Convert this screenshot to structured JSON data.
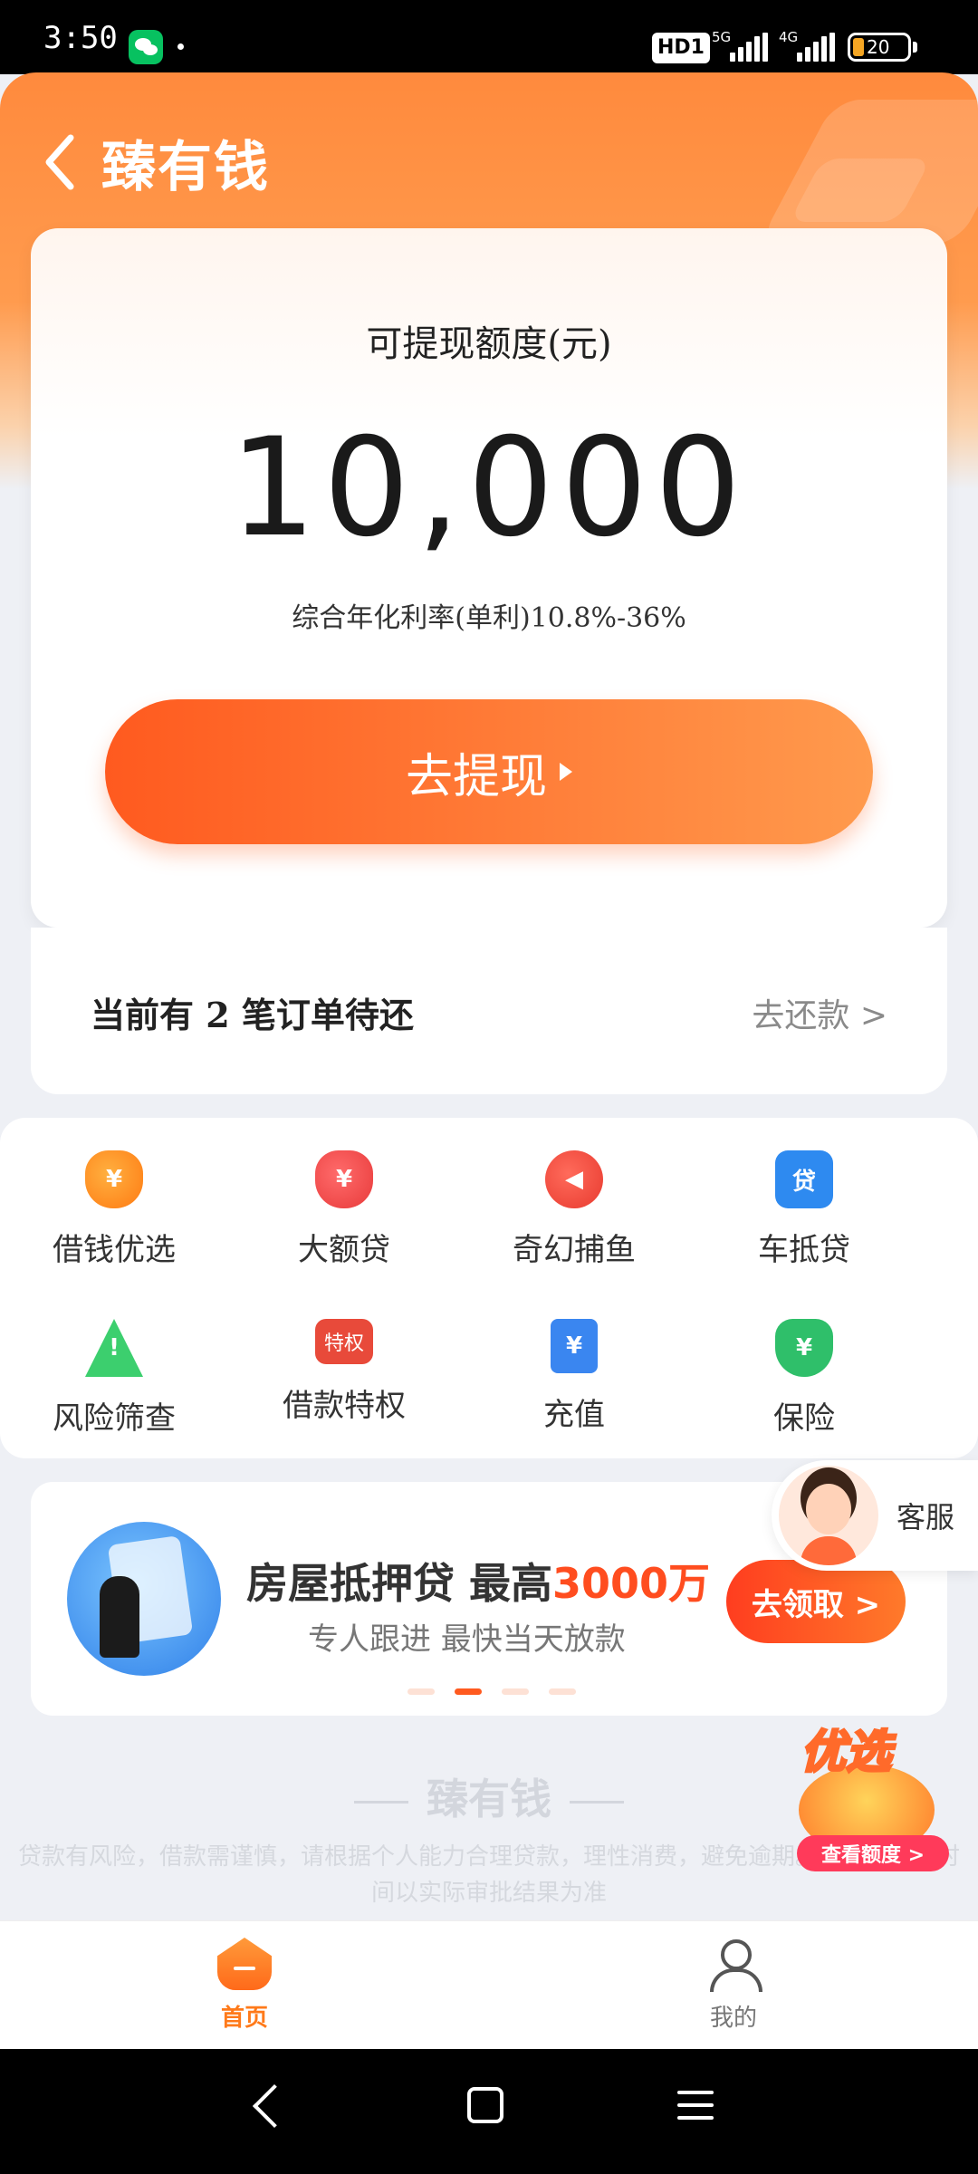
{
  "status_bar": {
    "time": "3:50",
    "hd_badge": "HD1",
    "net1": "5G",
    "net2": "4G",
    "battery": "20"
  },
  "header": {
    "title": "臻有钱"
  },
  "credit_card": {
    "label": "可提现额度(元)",
    "amount": "10,000",
    "rate_text": "综合年化利率(单利)10.8%-36%",
    "withdraw_button": "去提现"
  },
  "orders": {
    "text": "当前有 2 笔订单待还",
    "repay_link": "去还款 >"
  },
  "services": [
    {
      "label": "借钱优选",
      "icon": "money-bag-icon",
      "glyph": "¥"
    },
    {
      "label": "大额贷",
      "icon": "red-money-bag-icon",
      "glyph": "¥"
    },
    {
      "label": "奇幻捕鱼",
      "icon": "fish-icon",
      "glyph": "◀"
    },
    {
      "label": "车抵贷",
      "icon": "car-loan-icon",
      "glyph": "贷"
    },
    {
      "label": "风险筛查",
      "icon": "warning-icon",
      "glyph": "!"
    },
    {
      "label": "借款特权",
      "icon": "privilege-icon",
      "glyph": "特权"
    },
    {
      "label": "充值",
      "icon": "recharge-icon",
      "glyph": "¥"
    },
    {
      "label": "保险",
      "icon": "insurance-shield-icon",
      "glyph": "¥"
    }
  ],
  "banner": {
    "title_prefix": "房屋抵押贷 最高",
    "title_highlight": "3000万",
    "subtitle": "专人跟进 最快当天放款",
    "button": "去领取 >"
  },
  "customer_service": {
    "label": "客服"
  },
  "footer": {
    "brand": "臻有钱",
    "disclaimer": "贷款有风险，借款需谨慎，请根据个人能力合理贷款，理性消费，避免逾期。额度、放款时间以实际审批结果为准"
  },
  "promo": {
    "title": "优选",
    "button": "查看额度 >"
  },
  "bottom_nav": {
    "home": "首页",
    "mine": "我的"
  },
  "colors": {
    "accent": "#ff7a1a",
    "button_start": "#ff5a1f",
    "button_end": "#ff9a4d",
    "highlight": "#ff4d1f"
  }
}
